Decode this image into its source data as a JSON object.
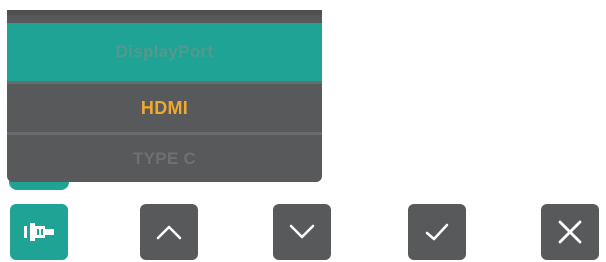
{
  "osd_menu": {
    "items": [
      {
        "label": "DisplayPort",
        "state": "highlighted"
      },
      {
        "label": "HDMI",
        "state": "selected"
      },
      {
        "label": "TYPE C",
        "state": "dim"
      }
    ]
  },
  "buttons": [
    {
      "icon": "input-source-icon"
    },
    {
      "icon": "chevron-up-icon"
    },
    {
      "icon": "chevron-down-icon"
    },
    {
      "icon": "checkmark-icon"
    },
    {
      "icon": "close-icon"
    }
  ],
  "colors": {
    "accent": "#1fa394",
    "panel": "#58595b",
    "selected_text": "#f1a830",
    "icon": "#ffffff"
  }
}
